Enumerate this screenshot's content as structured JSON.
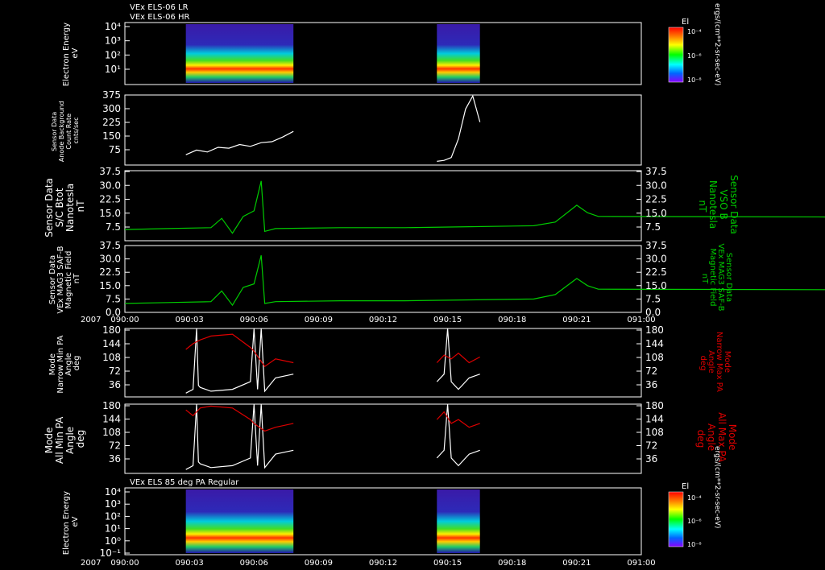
{
  "header_lines": [
    "VEx ELS-06 LR",
    "VEx ELS-06 HR"
  ],
  "bottom_header": "VEx ELS 85 deg PA Regular",
  "year_label": "2007",
  "x_ticks": [
    "090:00",
    "090:03",
    "090:06",
    "090:09",
    "090:12",
    "090:15",
    "090:18",
    "090:21",
    "091:00"
  ],
  "colors": {
    "white": "#ffffff",
    "green": "#00cc00",
    "red": "#dd0000"
  },
  "colorbar": {
    "title": "El",
    "units": "ergs/(cm**2-sr-sec-eV)",
    "top": {
      "labels": [
        "10⁻⁴",
        "10⁻⁶",
        "10⁻⁸"
      ]
    },
    "bottom": {
      "labels": [
        "10⁻⁴",
        "10⁻⁶",
        "10⁻⁸"
      ]
    }
  },
  "panels": {
    "p1": {
      "left_label": [
        "Electron Energy",
        "eV"
      ],
      "y_ticks": [
        "10⁴",
        "10³",
        "10²",
        "10¹"
      ]
    },
    "p2": {
      "left_label": [
        "Sensor Data",
        "Anode Background",
        "Count Rate",
        "cnts/sec"
      ],
      "y_ticks": [
        "375",
        "300",
        "225",
        "150",
        "75"
      ]
    },
    "p3": {
      "left_label": [
        "Sensor Data",
        "S/C Btot",
        "Nanotesla",
        "nT"
      ],
      "right_label": [
        "Sensor Data",
        "VSO B",
        "Nanotesla",
        "nT"
      ],
      "y_ticks": [
        "37.5",
        "30.0",
        "22.5",
        "15.0",
        "7.5"
      ]
    },
    "p4": {
      "left_label": [
        "Sensor Data",
        "VEx MAG3 SAF-B",
        "Magnetic Field",
        "nT"
      ],
      "right_label": [
        "Sensor Data",
        "VEx MAG3 SAF-B",
        "Magnetic Field",
        "nT"
      ],
      "y_ticks": [
        "37.5",
        "30.0",
        "22.5",
        "15.0",
        "7.5",
        "0.0"
      ]
    },
    "p5": {
      "left_label": [
        "Mode",
        "Narrow Min PA",
        "Angle",
        "deg"
      ],
      "right_label": [
        "Mode",
        "Narrow Max PA",
        "Angle",
        "deg"
      ],
      "y_ticks": [
        "180",
        "144",
        "108",
        "72",
        "36"
      ]
    },
    "p6": {
      "left_label": [
        "Mode",
        "All Min PA",
        "Angle",
        "deg"
      ],
      "right_label": [
        "Mode",
        "All Max PA",
        "Angle",
        "deg"
      ],
      "y_ticks": [
        "180",
        "144",
        "108",
        "72",
        "36"
      ]
    },
    "p7": {
      "left_label": [
        "Electron Energy",
        "eV"
      ],
      "y_ticks": [
        "10⁴",
        "10³",
        "10²",
        "10¹",
        "10⁰",
        "10⁻¹"
      ]
    }
  },
  "chart_data": [
    {
      "type": "heatmap",
      "title": "VEx ELS-06 LR / VEx ELS-06 HR",
      "ylabel": "Electron Energy eV",
      "yscale": "log",
      "ylim": [
        1,
        10000
      ],
      "x_range": [
        "090:00",
        "091:00"
      ],
      "data_intervals": [
        [
          "090:02:50",
          "090:07:50"
        ],
        [
          "090:14:30",
          "090:16:30"
        ]
      ]
    },
    {
      "type": "line",
      "ylabel": "Sensor Data Anode Background Count Rate cnts/sec",
      "ylim": [
        0,
        375
      ],
      "series": [
        {
          "x": [
            "090:02:50",
            "090:03:20",
            "090:03:50",
            "090:04:20",
            "090:04:50",
            "090:05:20",
            "090:05:50",
            "090:06:20",
            "090:06:50",
            "090:07:20",
            "090:07:50"
          ],
          "values": [
            55,
            80,
            70,
            95,
            90,
            110,
            100,
            120,
            125,
            150,
            180
          ]
        },
        {
          "x": [
            "090:14:30",
            "090:14:50",
            "090:15:10",
            "090:15:30",
            "090:15:50",
            "090:16:10",
            "090:16:30"
          ],
          "values": [
            20,
            25,
            40,
            140,
            300,
            370,
            230
          ]
        }
      ]
    },
    {
      "type": "line",
      "ylabel": "Sensor Data S/C Btot Nanotesla nT",
      "y2label": "Sensor Data VSO B Nanotesla nT",
      "ylim": [
        0,
        37.5
      ],
      "series": [
        {
          "x": [
            "090:00",
            "090:02",
            "090:04",
            "090:04:30",
            "090:05",
            "090:05:30",
            "090:06",
            "090:06:20",
            "090:06:30",
            "090:07",
            "090:10",
            "090:13",
            "090:16",
            "090:19",
            "090:20",
            "090:21",
            "090:21:30",
            "090:22",
            "091:00"
          ],
          "values": [
            6,
            6.5,
            7,
            12,
            4,
            13,
            16,
            32,
            5,
            6.5,
            7,
            7,
            7.5,
            8,
            10,
            19,
            15,
            13,
            12
          ]
        }
      ]
    },
    {
      "type": "line",
      "ylabel": "Sensor Data VEx MAG3 SAF-B Magnetic Field nT",
      "y2label": "Sensor Data VEx MAG3 SAF-B Magnetic Field nT",
      "ylim": [
        0,
        37.5
      ],
      "series": [
        {
          "x": [
            "090:00",
            "090:02",
            "090:04",
            "090:04:30",
            "090:05",
            "090:05:30",
            "090:06",
            "090:06:20",
            "090:06:30",
            "090:07",
            "090:10",
            "090:13",
            "090:16",
            "090:19",
            "090:20",
            "090:21",
            "090:21:30",
            "090:22",
            "091:00"
          ],
          "values": [
            5,
            5.5,
            6,
            12,
            4,
            14,
            16,
            32,
            5,
            6,
            6.5,
            6.5,
            7,
            7.5,
            10,
            19,
            15,
            13,
            12
          ]
        }
      ]
    },
    {
      "type": "line",
      "ylabel": "Mode Narrow Min PA Angle deg",
      "y2label": "Mode Narrow Max PA Angle deg",
      "ylim": [
        0,
        180
      ],
      "series": [
        {
          "x": [
            "090:02:50",
            "090:03:10",
            "090:03:20",
            "090:03:25",
            "090:03:30",
            "090:04",
            "090:05",
            "090:05:50",
            "090:06",
            "090:06:10",
            "090:06:20",
            "090:06:30",
            "090:07",
            "090:07:50"
          ],
          "values": [
            10,
            20,
            180,
            30,
            25,
            15,
            20,
            40,
            180,
            20,
            180,
            15,
            50,
            60
          ]
        },
        {
          "x": [
            "090:14:30",
            "090:14:50",
            "090:15:00",
            "090:15:10",
            "090:15:30",
            "090:16:00",
            "090:16:30"
          ],
          "values": [
            40,
            60,
            180,
            40,
            20,
            50,
            60
          ]
        },
        {
          "x": [
            "090:02:50",
            "090:03:10",
            "090:03:30",
            "090:04",
            "090:05",
            "090:05:50",
            "090:06",
            "090:06:30",
            "090:07",
            "090:07:50"
          ],
          "values": [
            125,
            140,
            150,
            160,
            165,
            130,
            120,
            80,
            100,
            90
          ]
        },
        {
          "x": [
            "090:14:30",
            "090:14:50",
            "090:15:10",
            "090:15:30",
            "090:16:00",
            "090:16:30"
          ],
          "values": [
            90,
            110,
            100,
            115,
            90,
            105
          ]
        }
      ]
    },
    {
      "type": "line",
      "ylabel": "Mode All Min PA Angle deg",
      "y2label": "Mode All Max PA Angle deg",
      "ylim": [
        0,
        180
      ],
      "series": [
        {
          "x": [
            "090:02:50",
            "090:03:10",
            "090:03:20",
            "090:03:25",
            "090:03:30",
            "090:04",
            "090:05",
            "090:05:50",
            "090:06",
            "090:06:10",
            "090:06:20",
            "090:06:30",
            "090:07",
            "090:07:50"
          ],
          "values": [
            10,
            20,
            180,
            30,
            25,
            15,
            20,
            40,
            180,
            20,
            180,
            15,
            50,
            60
          ]
        },
        {
          "x": [
            "090:14:30",
            "090:14:50",
            "090:15:00",
            "090:15:10",
            "090:15:30",
            "090:16:00",
            "090:16:30"
          ],
          "values": [
            40,
            60,
            180,
            40,
            20,
            50,
            60
          ]
        },
        {
          "x": [
            "090:02:50",
            "090:03:10",
            "090:03:30",
            "090:04",
            "090:05",
            "090:05:50",
            "090:06",
            "090:06:30",
            "090:07",
            "090:07:50"
          ],
          "values": [
            165,
            150,
            170,
            175,
            170,
            140,
            130,
            110,
            120,
            130
          ]
        },
        {
          "x": [
            "090:14:30",
            "090:14:50",
            "090:15:10",
            "090:15:30",
            "090:16:00",
            "090:16:30"
          ],
          "values": [
            140,
            160,
            130,
            140,
            120,
            130
          ]
        }
      ]
    },
    {
      "type": "heatmap",
      "title": "VEx ELS 85 deg PA Regular",
      "ylabel": "Electron Energy eV",
      "yscale": "log",
      "ylim": [
        0.1,
        10000
      ],
      "x_range": [
        "090:00",
        "091:00"
      ],
      "data_intervals": [
        [
          "090:02:50",
          "090:07:50"
        ],
        [
          "090:14:30",
          "090:16:30"
        ]
      ]
    }
  ]
}
